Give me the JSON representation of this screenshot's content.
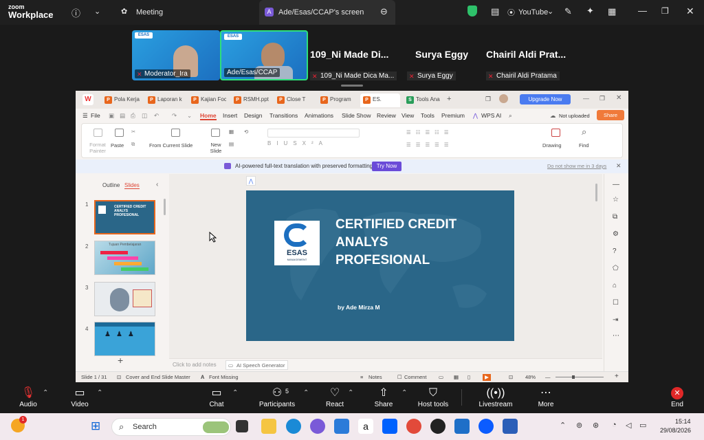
{
  "zoom": {
    "brand_top": "zoom",
    "brand_bottom": "Workplace",
    "meeting_label": "Meeting",
    "share_title": "Ade/Esas/CCAP's screen",
    "share_badge": "A",
    "youtube_label": "YouTube"
  },
  "participants": [
    {
      "name": "Moderator_Ira"
    },
    {
      "name": "Ade/Esas/CCAP"
    },
    {
      "big": "109_Ni Made Di...",
      "small": "109_Ni Made Dica Ma..."
    },
    {
      "big": "Surya Eggy",
      "small": "Surya Eggy"
    },
    {
      "big": "Chairil Aldi Prat...",
      "small": "Chairil Aldi Pratama"
    }
  ],
  "tile_logo": "ESAS",
  "wps": {
    "tabs": [
      "Pola Kerja",
      "Laporan k",
      "Kajian Foc",
      "RSMH.ppt",
      "Close T",
      "Program",
      "ES.",
      "Tools Ana"
    ],
    "upgrade": "Upgrade Now",
    "menu": {
      "file": "File",
      "items": [
        "Home",
        "Insert",
        "Design",
        "Transitions",
        "Animations",
        "Slide Show",
        "Review",
        "View",
        "Tools",
        "Premium"
      ],
      "wps_ai": "WPS AI",
      "not_uploaded": "Not uploaded",
      "share": "Share"
    },
    "ribbon": {
      "format_painter": "Format Painter",
      "paste": "Paste",
      "from_current": "From Current Slide",
      "new_slide": "New Slide",
      "drawing": "Drawing",
      "find": "Find"
    },
    "notice": {
      "text": "AI-powered full-text translation with preserved formatting.",
      "try": "Try Now",
      "dismiss": "Do not show me in 3 days"
    },
    "panel": {
      "outline": "Outline",
      "slides": "Slides",
      "thumb_numbers": [
        "1",
        "2",
        "3",
        "4"
      ],
      "thumb1_text": "CERTIFIED CREDIT ANALYS PROFESIONAL",
      "thumb2_text": "Tujuan Pembelajaran"
    },
    "slide": {
      "title_line1": "CERTIFIED CREDIT",
      "title_line2": "ANALYS",
      "title_line3": "PROFESIONAL",
      "logo_text": "ESAS",
      "logo_sub": "MANAGEMENT",
      "byline": "by Ade Mirza M"
    },
    "notes": {
      "placeholder": "Click to add notes",
      "ai_gen": "AI Speech Generator"
    },
    "status": {
      "slide_count": "Slide 1 / 31",
      "master": "Cover and End Slide Master",
      "font_missing": "Font Missing",
      "notes": "Notes",
      "comment": "Comment",
      "zoom": "48%"
    }
  },
  "controls": {
    "audio": "Audio",
    "video": "Video",
    "chat": "Chat",
    "participants": "Participants",
    "participants_count": "5",
    "react": "React",
    "share": "Share",
    "host_tools": "Host tools",
    "livestream": "Livestream",
    "more": "More",
    "end": "End"
  },
  "taskbar": {
    "search": "Search",
    "time": "15:14",
    "date": "29/08/2026",
    "badge": "1"
  }
}
